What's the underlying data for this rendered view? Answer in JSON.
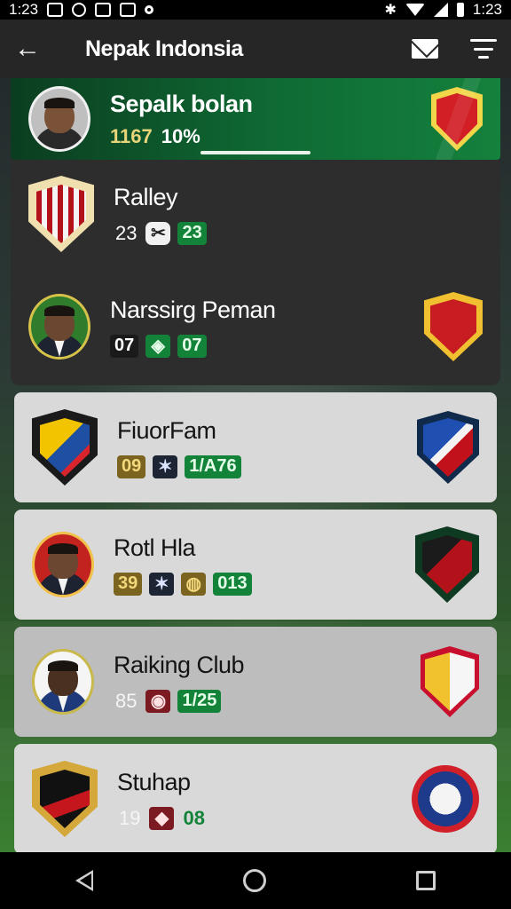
{
  "status_bar": {
    "time_left": "1:23",
    "time_right": "1:23"
  },
  "app_bar": {
    "back_glyph": "←",
    "title": "Nepak Indonsia",
    "icons": [
      "back-arrow-icon",
      "mail-icon",
      "filter-icon"
    ]
  },
  "featured": {
    "name": "Sepalk bolan",
    "stat_a": "1167",
    "stat_b": "10%"
  },
  "rows": [
    {
      "name": "Ralley",
      "stat1": "23",
      "stat2": "23"
    },
    {
      "name": "Narssirg Peman",
      "stat1": "07",
      "stat2": "07"
    },
    {
      "name": "FiuorFam",
      "stat1": "09",
      "stat3": "1/A76"
    },
    {
      "name": "Rotl Hla",
      "stat1": "39",
      "stat3": "013"
    },
    {
      "name": "Raiking Club",
      "stat1": "85",
      "stat3": "1/25"
    },
    {
      "name": "Stuhap",
      "stat1": "19",
      "stat3": "08"
    }
  ],
  "colors": {
    "accent_green": "#14833a",
    "gold": "#7a6420",
    "dark_card": "#2d2d2d",
    "light_card": "#d9d9d9"
  }
}
